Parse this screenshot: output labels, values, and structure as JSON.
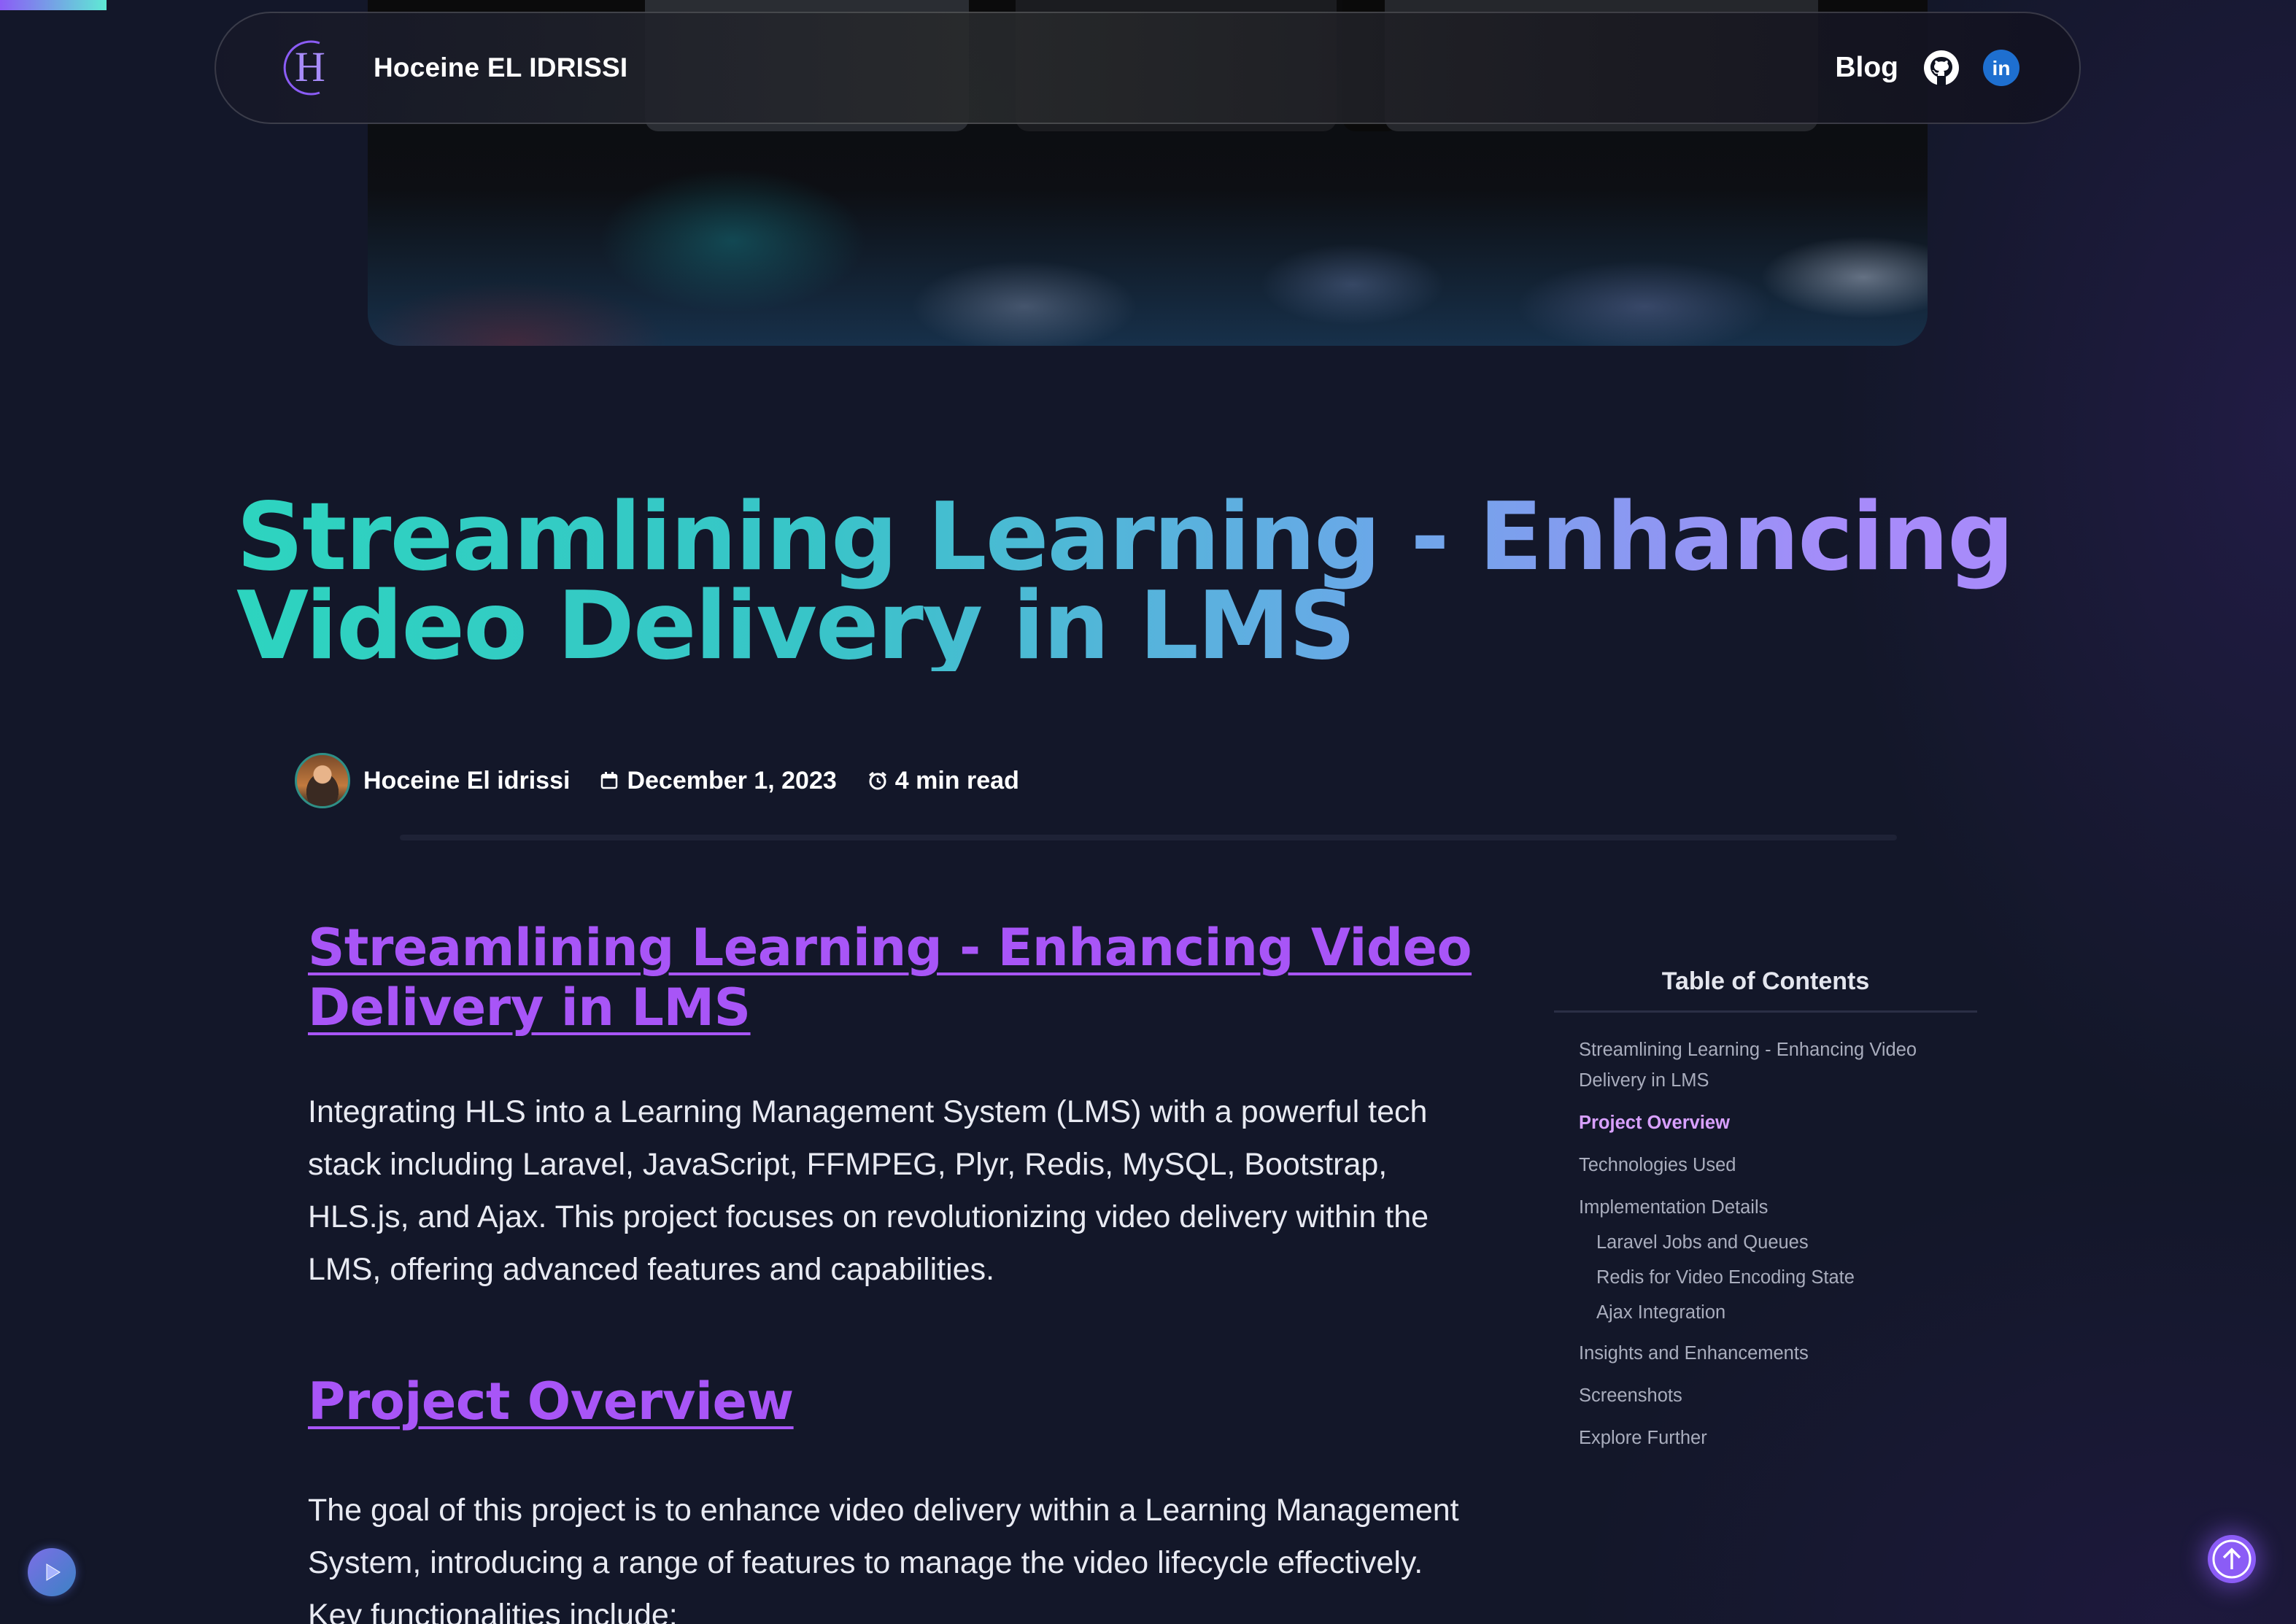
{
  "nav": {
    "logo_letter": "H",
    "brand": "Hoceine EL IDRISSI",
    "blog_label": "Blog",
    "github_icon": "github-icon",
    "linkedin_icon": "linkedin-icon",
    "linkedin_text": "in"
  },
  "colors": {
    "background": "#131729",
    "accent_purple": "#a855f7",
    "title_gradient_start": "#2dd4bf",
    "title_gradient_end": "#a78bfa",
    "toc_active": "#d8a0ff"
  },
  "post": {
    "title": "Streamlining Learning - Enhancing Video Delivery in LMS",
    "author": "Hoceine El idrissi",
    "date": "December 1, 2023",
    "read_time": "4 min read"
  },
  "article": {
    "heading_main": "Streamlining Learning - Enhancing Video Delivery in LMS",
    "intro": "Integrating HLS into a Learning Management System (LMS) with a powerful tech stack including Laravel, JavaScript, FFMPEG, Plyr, Redis, MySQL, Bootstrap, HLS.js, and Ajax. This project focuses on revolutionizing video delivery within the LMS, offering advanced features and capabilities.",
    "heading_overview": "Project Overview",
    "goal": "The goal of this project is to enhance video delivery within a Learning Management System, introducing a range of features to manage the video lifecycle effectively. Key functionalities include:"
  },
  "toc": {
    "title": "Table of Contents",
    "items": [
      {
        "label": "Streamlining Learning - Enhancing Video Delivery in LMS"
      },
      {
        "label": "Project Overview"
      },
      {
        "label": "Technologies Used"
      },
      {
        "label": "Implementation Details"
      },
      {
        "label": "Laravel Jobs and Queues"
      },
      {
        "label": "Redis for Video Encoding State"
      },
      {
        "label": "Ajax Integration"
      },
      {
        "label": "Insights and Enhancements"
      },
      {
        "label": "Screenshots"
      },
      {
        "label": "Explore Further"
      }
    ],
    "active": "Project Overview"
  },
  "icons": {
    "calendar": "calendar-icon",
    "clock": "alarm-clock-icon",
    "play": "play-icon",
    "back_to_top": "arrow-up-icon"
  }
}
